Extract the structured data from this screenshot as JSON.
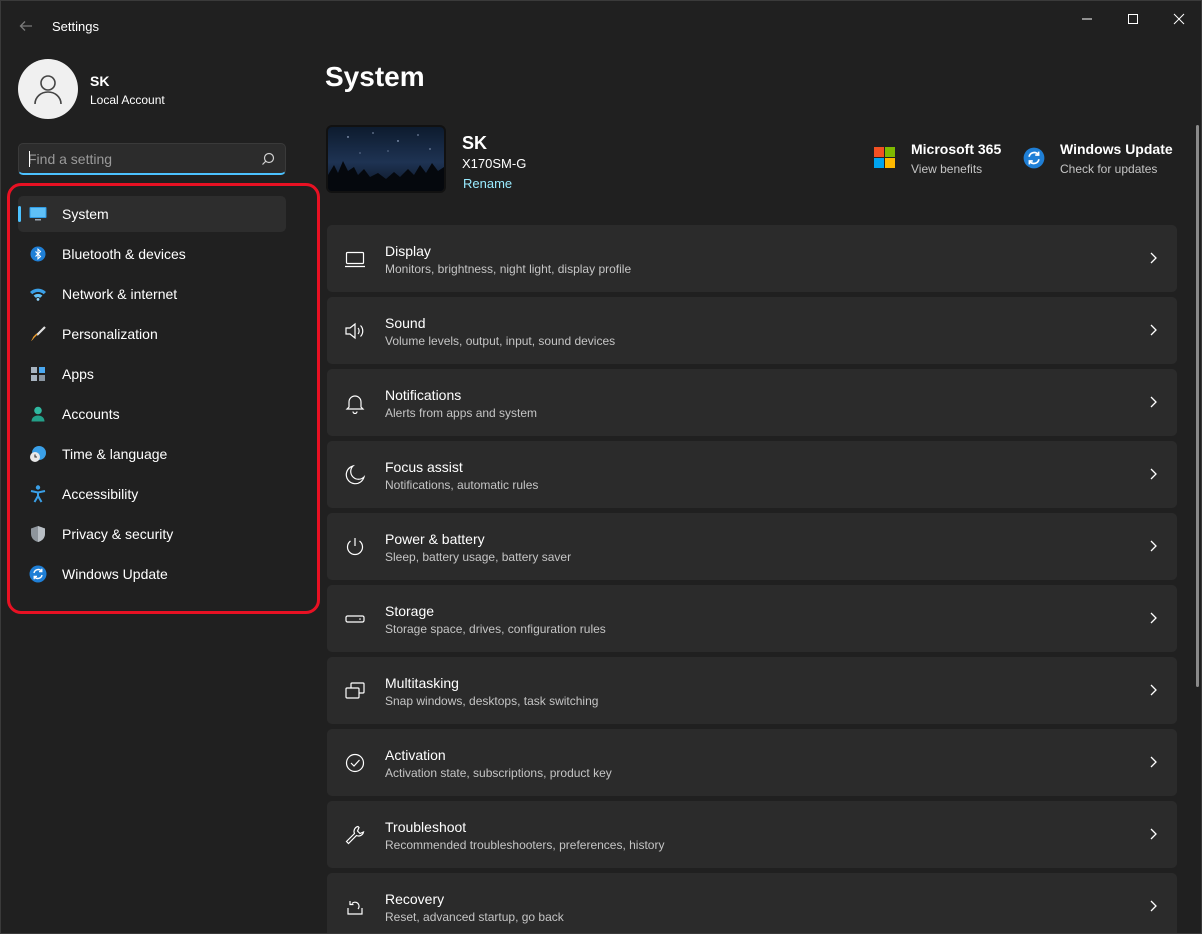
{
  "window": {
    "title": "Settings"
  },
  "profile": {
    "name": "SK",
    "account_type": "Local Account"
  },
  "search": {
    "placeholder": "Find a setting",
    "value": ""
  },
  "sidebar": {
    "items": [
      {
        "label": "System",
        "icon": "monitor-icon",
        "active": true
      },
      {
        "label": "Bluetooth & devices",
        "icon": "bluetooth-icon"
      },
      {
        "label": "Network & internet",
        "icon": "wifi-icon"
      },
      {
        "label": "Personalization",
        "icon": "brush-icon"
      },
      {
        "label": "Apps",
        "icon": "apps-icon"
      },
      {
        "label": "Accounts",
        "icon": "person-icon"
      },
      {
        "label": "Time & language",
        "icon": "globe-clock-icon"
      },
      {
        "label": "Accessibility",
        "icon": "accessibility-icon"
      },
      {
        "label": "Privacy & security",
        "icon": "shield-icon"
      },
      {
        "label": "Windows Update",
        "icon": "sync-icon"
      }
    ]
  },
  "main": {
    "title": "System",
    "device": {
      "name": "SK",
      "model": "X170SM-G",
      "rename_label": "Rename"
    },
    "quick_links": [
      {
        "title": "Microsoft 365",
        "subtitle": "View benefits",
        "icon": "microsoft-logo-icon"
      },
      {
        "title": "Windows Update",
        "subtitle": "Check for updates",
        "icon": "sync-icon"
      }
    ],
    "settings": [
      {
        "title": "Display",
        "subtitle": "Monitors, brightness, night light, display profile",
        "icon": "display-icon"
      },
      {
        "title": "Sound",
        "subtitle": "Volume levels, output, input, sound devices",
        "icon": "speaker-icon"
      },
      {
        "title": "Notifications",
        "subtitle": "Alerts from apps and system",
        "icon": "bell-icon"
      },
      {
        "title": "Focus assist",
        "subtitle": "Notifications, automatic rules",
        "icon": "moon-icon"
      },
      {
        "title": "Power & battery",
        "subtitle": "Sleep, battery usage, battery saver",
        "icon": "power-icon"
      },
      {
        "title": "Storage",
        "subtitle": "Storage space, drives, configuration rules",
        "icon": "storage-icon"
      },
      {
        "title": "Multitasking",
        "subtitle": "Snap windows, desktops, task switching",
        "icon": "multitasking-icon"
      },
      {
        "title": "Activation",
        "subtitle": "Activation state, subscriptions, product key",
        "icon": "check-circle-icon"
      },
      {
        "title": "Troubleshoot",
        "subtitle": "Recommended troubleshooters, preferences, history",
        "icon": "wrench-icon"
      },
      {
        "title": "Recovery",
        "subtitle": "Reset, advanced startup, go back",
        "icon": "recovery-icon"
      }
    ]
  },
  "colors": {
    "accent": "#4cc2ff",
    "highlight": "#e81123",
    "background": "#202020",
    "card": "#2b2b2b"
  }
}
